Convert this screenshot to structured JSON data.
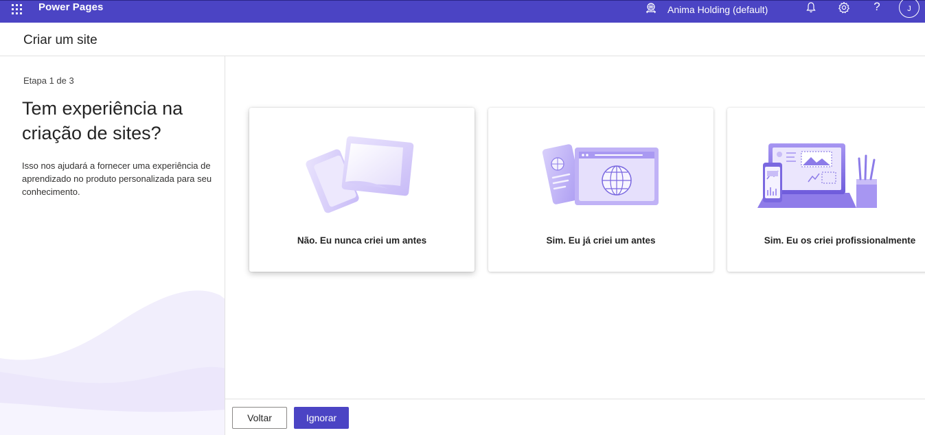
{
  "topbar": {
    "app_title": "Power Pages",
    "environment": "Anima Holding (default)",
    "help_label": "?",
    "avatar_initial": "J"
  },
  "header": {
    "title": "Criar um site"
  },
  "left_panel": {
    "step": "Etapa 1 de 3",
    "question": "Tem experiência na criação de sites?",
    "description": "Isso nos ajudará a fornecer uma experiência de aprendizado no produto personalizada para seu conhecimento."
  },
  "options": [
    {
      "label": "Não. Eu nunca criei um antes",
      "selected": true
    },
    {
      "label": "Sim. Eu já criei um antes",
      "selected": false
    },
    {
      "label": "Sim. Eu os criei profissionalmente",
      "selected": false
    }
  ],
  "footer": {
    "back_label": "Voltar",
    "skip_label": "Ignorar"
  },
  "colors": {
    "brand": "#4b44c4",
    "illustration": "#b9a9f5"
  }
}
